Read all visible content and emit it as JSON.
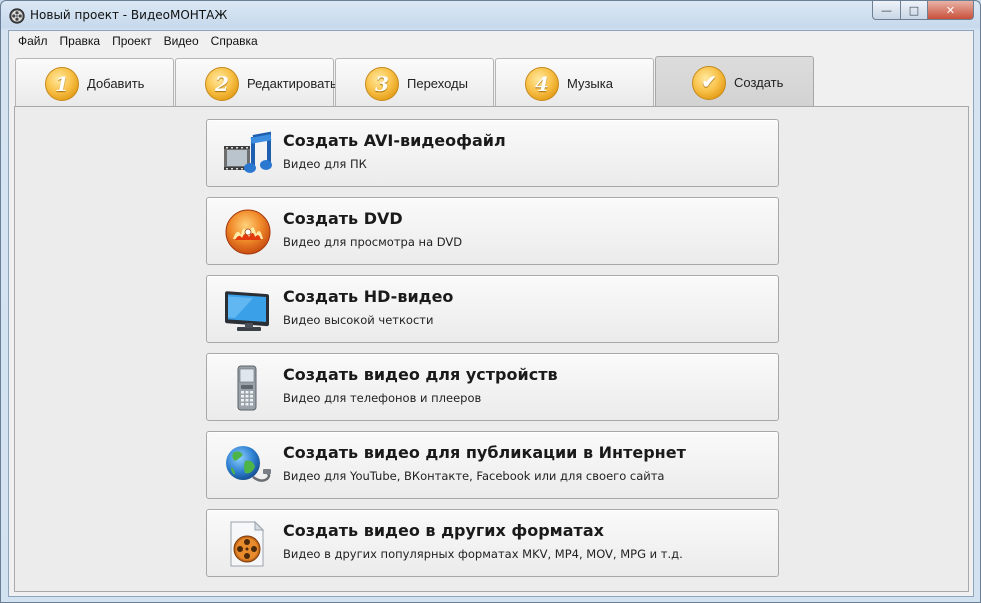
{
  "window": {
    "title": "Новый проект - ВидеоМОНТАЖ",
    "controls": {
      "minimize": "—",
      "maximize": "□",
      "close": "✕"
    }
  },
  "menu": [
    "Файл",
    "Правка",
    "Проект",
    "Видео",
    "Справка"
  ],
  "tabs": [
    {
      "num": "1",
      "label": "Добавить",
      "active": false
    },
    {
      "num": "2",
      "label": "Редактировать",
      "active": false
    },
    {
      "num": "3",
      "label": "Переходы",
      "active": false
    },
    {
      "num": "4",
      "label": "Музыка",
      "active": false
    },
    {
      "num": "✔",
      "label": "Создать",
      "active": true
    }
  ],
  "options": [
    {
      "icon": "film-music-icon",
      "title": "Создать AVI-видеофайл",
      "subtitle": "Видео для ПК"
    },
    {
      "icon": "dvd-disc-icon",
      "title": "Создать DVD",
      "subtitle": "Видео для просмотра на DVD"
    },
    {
      "icon": "monitor-icon",
      "title": "Создать HD-видео",
      "subtitle": "Видео высокой четкости"
    },
    {
      "icon": "mobile-phone-icon",
      "title": "Создать видео для устройств",
      "subtitle": "Видео для телефонов и плееров"
    },
    {
      "icon": "globe-network-icon",
      "title": "Создать видео для публикации в Интернет",
      "subtitle": "Видео для YouTube, ВКонтакте, Facebook или для своего сайта"
    },
    {
      "icon": "film-reel-file-icon",
      "title": "Создать видео в других форматах",
      "subtitle": "Видео в других популярных форматах MKV, MP4, MOV, MPG и т.д."
    }
  ],
  "colors": {
    "tab_badge": "#f4b536",
    "panel_bg": "#ececec"
  }
}
